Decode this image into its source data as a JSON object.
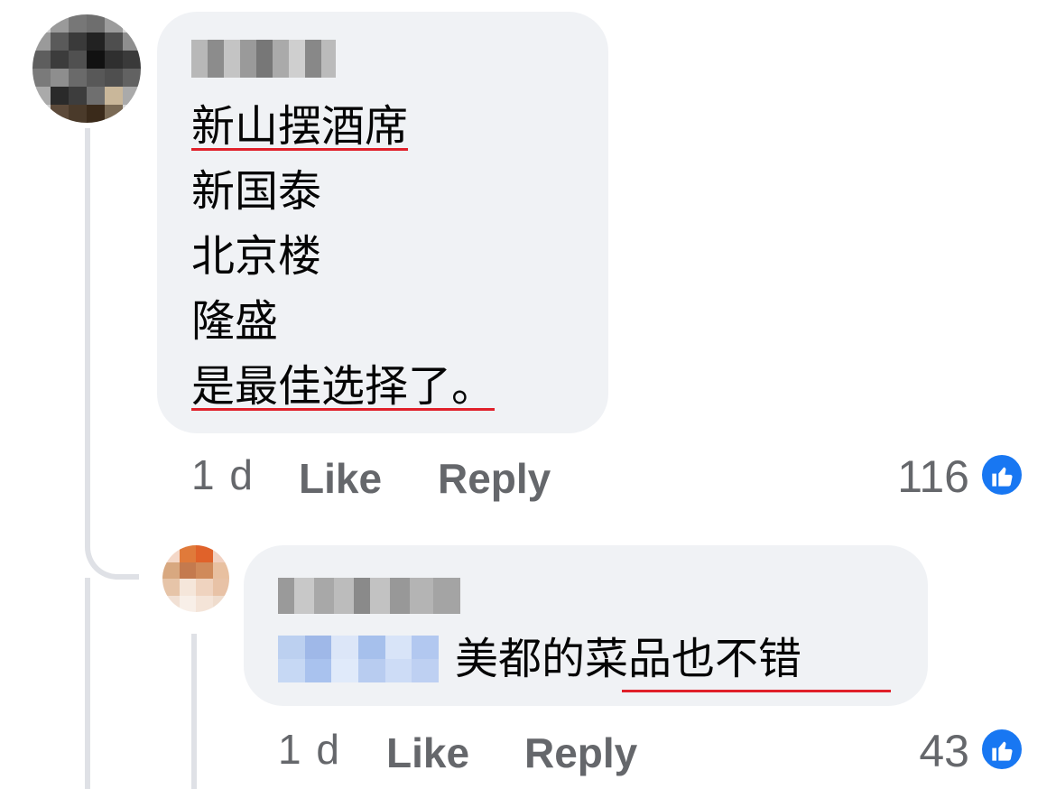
{
  "comment": {
    "lines": [
      "新山摆酒席",
      "新国泰",
      "北京楼",
      "隆盛",
      "是最佳选择了。"
    ],
    "time": "1 d",
    "like_label": "Like",
    "reply_label": "Reply",
    "reaction_count": "116",
    "reaction_icon": "thumbs-up-icon"
  },
  "reply": {
    "text": "美都的菜品也不错",
    "time": "1 d",
    "like_label": "Like",
    "reply_label": "Reply",
    "reaction_count": "43",
    "reaction_icon": "thumbs-up-icon"
  },
  "colors": {
    "bubble": "#f0f2f5",
    "underline": "#e0202a",
    "like_blue": "#1877f2",
    "muted_text": "#65676b"
  }
}
